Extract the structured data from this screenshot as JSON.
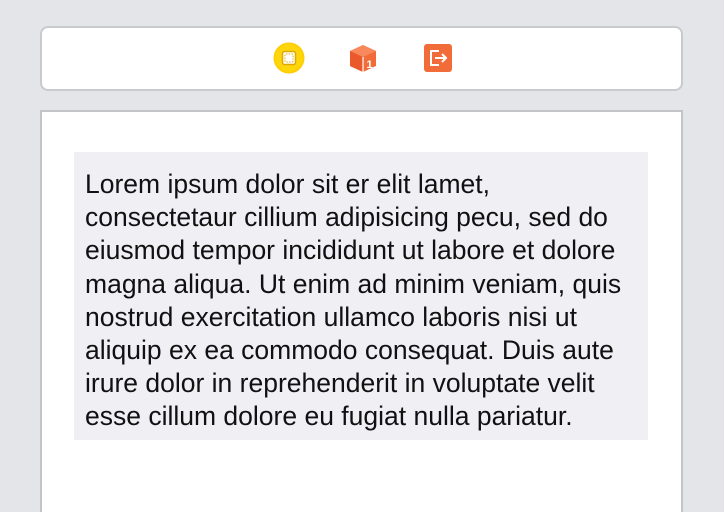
{
  "dock": {
    "icons": [
      {
        "name": "view-controller-icon",
        "color": "#ffcc00"
      },
      {
        "name": "first-responder-icon",
        "color": "#f26c3a",
        "badge": "1"
      },
      {
        "name": "exit-icon",
        "color": "#f26c3a"
      }
    ]
  },
  "text_view": {
    "background": "#efeff4",
    "body": "Lorem ipsum dolor sit er elit lamet, consectetaur cillium adipisicing pecu, sed do eiusmod tempor incididunt ut labore et dolore magna aliqua. Ut enim ad minim veniam, quis nostrud exercitation ullamco laboris nisi ut aliquip ex ea commodo consequat. Duis aute irure dolor in reprehenderit in voluptate velit esse cillum dolore eu fugiat nulla pariatur."
  }
}
